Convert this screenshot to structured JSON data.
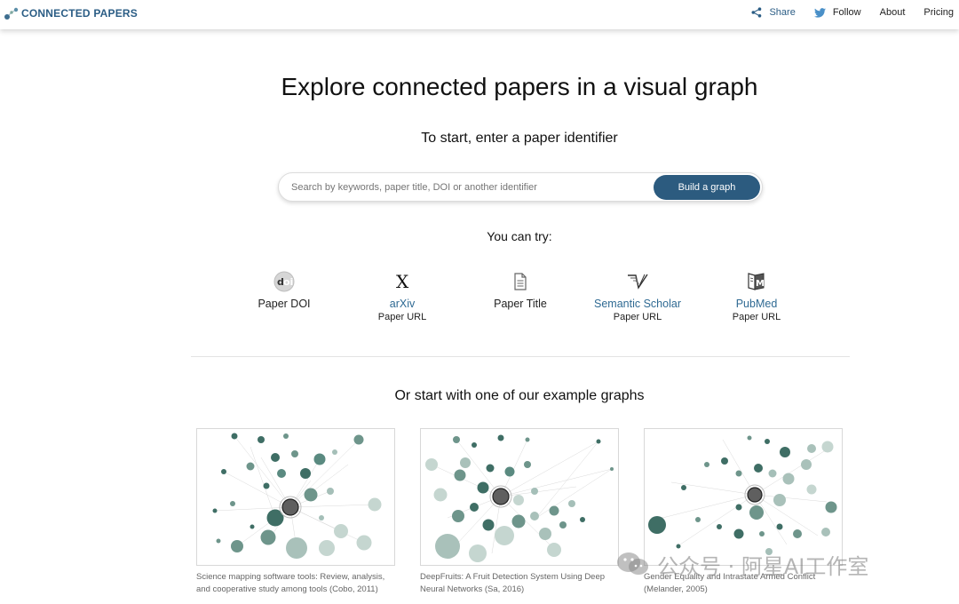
{
  "brand": {
    "name": "CONNECTED PAPERS",
    "color": "#2b5d85"
  },
  "nav": {
    "share": "Share",
    "follow": "Follow",
    "about": "About",
    "pricing": "Pricing"
  },
  "hero": {
    "title": "Explore connected papers in a visual graph",
    "subtitle": "To start, enter a paper identifier"
  },
  "search": {
    "placeholder": "Search by keywords, paper title, DOI or another identifier",
    "value": "",
    "button": "Build a graph"
  },
  "try": {
    "label": "You can try:",
    "items": [
      {
        "icon": "doi-icon",
        "title": "Paper DOI",
        "sub": ""
      },
      {
        "icon": "arxiv-icon",
        "title": "arXiv",
        "sub": "Paper URL"
      },
      {
        "icon": "document-icon",
        "title": "Paper Title",
        "sub": ""
      },
      {
        "icon": "semantic-scholar-icon",
        "title": "Semantic Scholar",
        "sub": "Paper URL"
      },
      {
        "icon": "pubmed-icon",
        "title": "PubMed",
        "sub": "Paper URL"
      }
    ]
  },
  "examples": {
    "title": "Or start with one of our example graphs",
    "cards": [
      {
        "caption_1": "Science mapping software tools: Review, analysis,",
        "caption_2": "and cooperative study among tools (Cobo, 2011)"
      },
      {
        "caption_1": "DeepFruits: A Fruit Detection System Using Deep",
        "caption_2": "Neural Networks (Sa, 2016)"
      },
      {
        "caption_1": "Gender Equality and Intrastate Armed Conflict",
        "caption_2": "(Melander, 2005)"
      }
    ]
  },
  "watermark": {
    "text": "公众号 · 阿星AI工作室"
  },
  "colors": {
    "accent": "#2c5b7f",
    "link": "#2f6a93",
    "node_dark": "#3f6e65",
    "node_light": "#c8d8d2"
  }
}
